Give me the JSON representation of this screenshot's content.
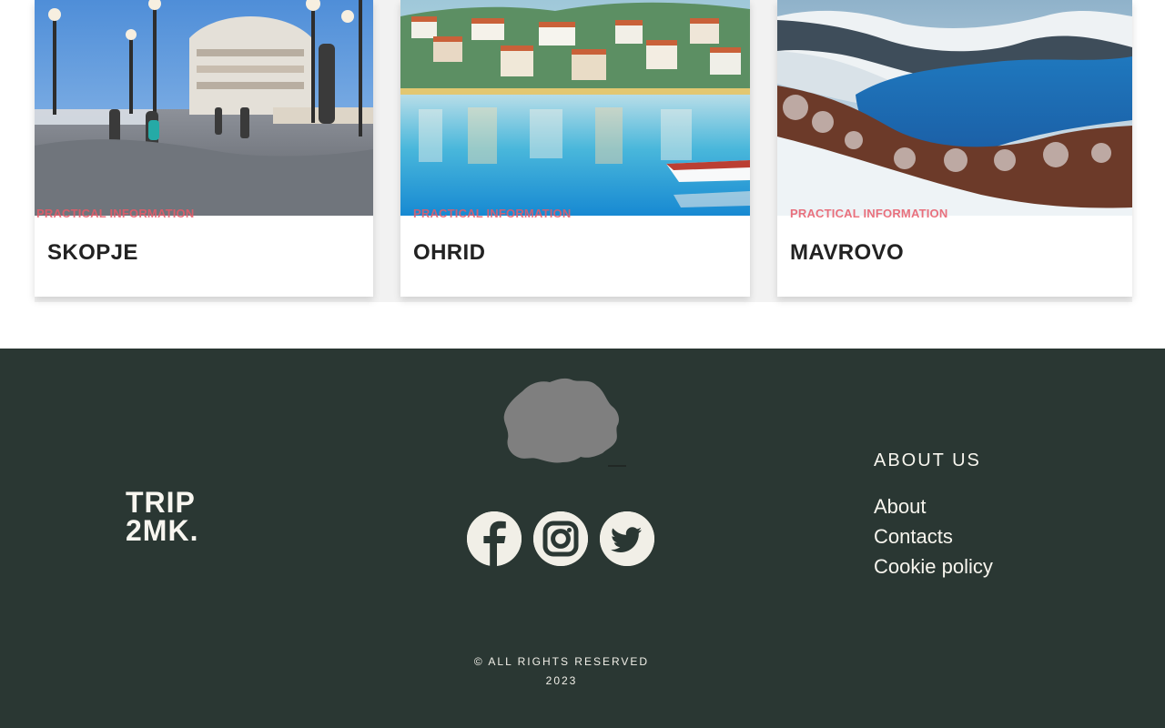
{
  "cards": [
    {
      "category": "Practical information",
      "title": "SKOPJE"
    },
    {
      "category": "Practical information",
      "title": "OHRID"
    },
    {
      "category": "Practical information",
      "title": "MAVROVO"
    }
  ],
  "footer": {
    "brand": {
      "line1": "TRIP",
      "line2": "2MK."
    },
    "social": [
      {
        "name": "facebook-icon"
      },
      {
        "name": "instagram-icon"
      },
      {
        "name": "twitter-icon"
      }
    ],
    "about": {
      "heading": "ABOUT US",
      "links": [
        {
          "label": "About"
        },
        {
          "label": "Contacts"
        },
        {
          "label": "Cookie policy"
        }
      ]
    },
    "copyright": {
      "line1": "© ALL RIGHTS RESERVED",
      "line2": "2023"
    },
    "colors": {
      "footer_background": "#2a3733",
      "light_text": "#f3f1ea",
      "icon_background": "#f1efe7",
      "map_gray": "#7f7f7f",
      "category_red": "#e85a68"
    }
  }
}
